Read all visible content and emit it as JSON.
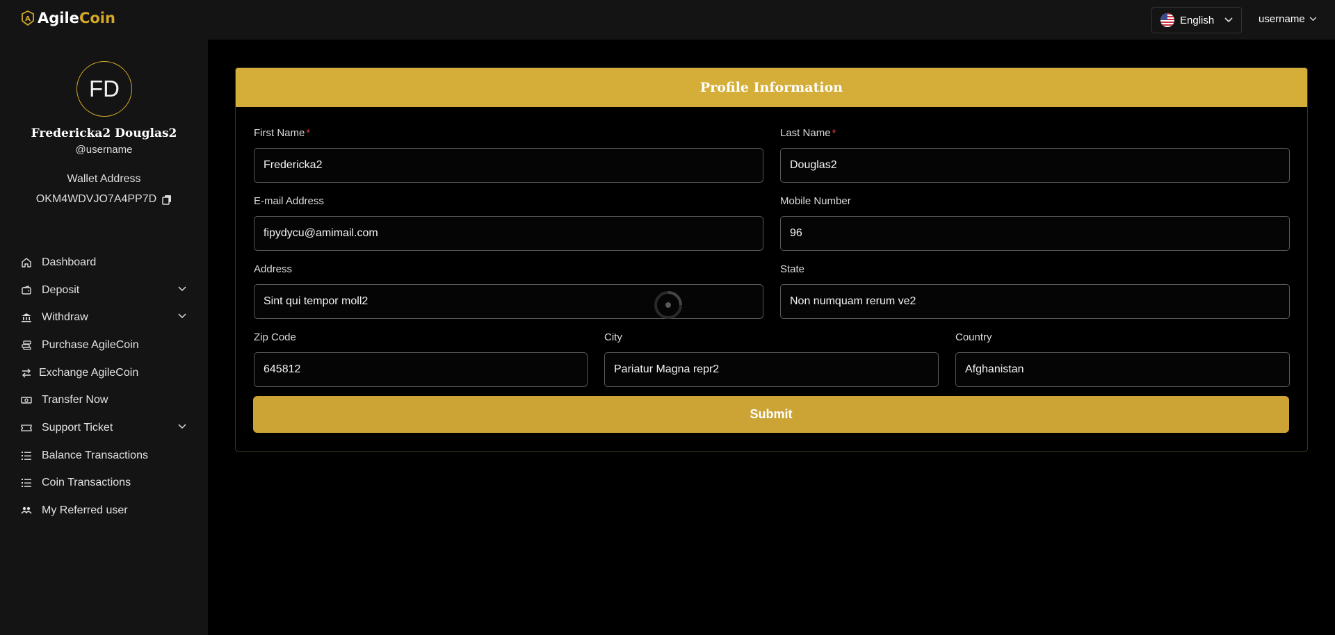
{
  "brand": {
    "name_part1": "Agile",
    "name_part2": "Coin",
    "accent": "#d4a82a"
  },
  "header": {
    "language": "English",
    "user_menu": "username"
  },
  "profile": {
    "initials": "FD",
    "full_name": "Fredericka2 Douglas2",
    "handle": "@username",
    "wallet_label": "Wallet Address",
    "wallet_address": "OKM4WDVJO7A4PP7D"
  },
  "nav": [
    {
      "label": "Dashboard",
      "icon": "home-icon",
      "has_caret": false
    },
    {
      "label": "Deposit",
      "icon": "wallet-icon",
      "has_caret": true
    },
    {
      "label": "Withdraw",
      "icon": "bank-icon",
      "has_caret": true
    },
    {
      "label": "Purchase AgileCoin",
      "icon": "coins-icon",
      "has_caret": false
    },
    {
      "label": "Exchange AgileCoin",
      "icon": "exchange-icon",
      "has_caret": false
    },
    {
      "label": "Transfer Now",
      "icon": "money-icon",
      "has_caret": false
    },
    {
      "label": "Support Ticket",
      "icon": "ticket-icon",
      "has_caret": true
    },
    {
      "label": "Balance Transactions",
      "icon": "list-icon",
      "has_caret": false
    },
    {
      "label": "Coin Transactions",
      "icon": "list-icon",
      "has_caret": false
    },
    {
      "label": "My Referred user",
      "icon": "users-icon",
      "has_caret": false
    }
  ],
  "form": {
    "title": "Profile Information",
    "first_name": {
      "label": "First Name",
      "required": "*",
      "value": "Fredericka2"
    },
    "last_name": {
      "label": "Last Name",
      "required": "*",
      "value": "Douglas2"
    },
    "email": {
      "label": "E-mail Address",
      "value": "fipydycu@amimail.com"
    },
    "mobile": {
      "label": "Mobile Number",
      "value": "96"
    },
    "address": {
      "label": "Address",
      "value": "Sint qui tempor moll2"
    },
    "state": {
      "label": "State",
      "value": "Non numquam rerum ve2"
    },
    "zip": {
      "label": "Zip Code",
      "value": "645812"
    },
    "city": {
      "label": "City",
      "value": "Pariatur Magna repr2"
    },
    "country": {
      "label": "Country",
      "value": "Afghanistan"
    },
    "submit_label": "Submit"
  }
}
